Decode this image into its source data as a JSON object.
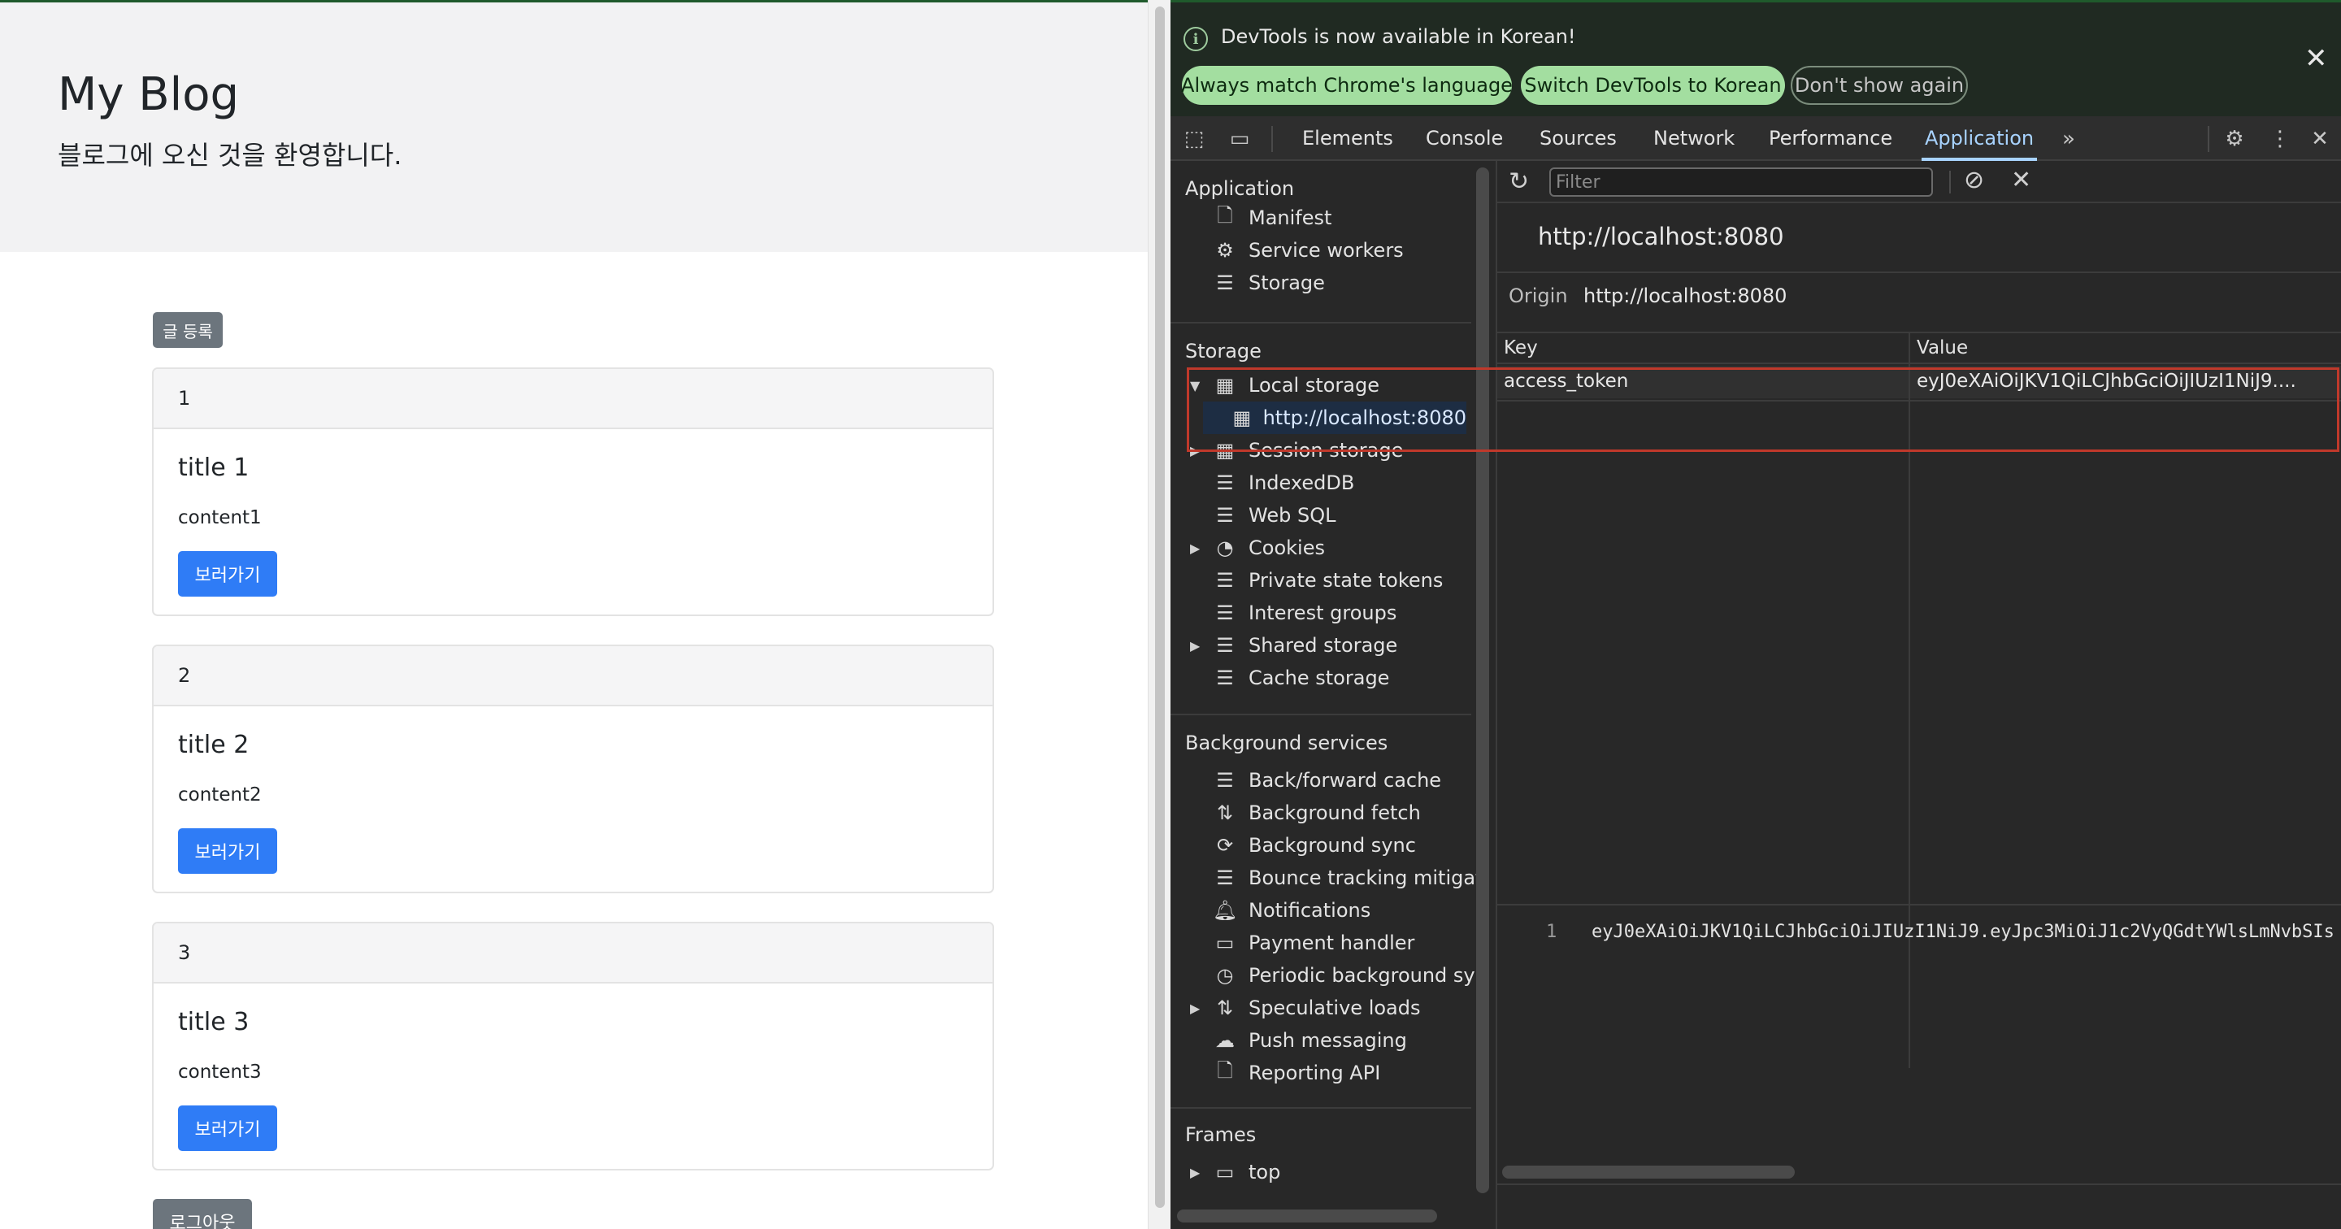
{
  "page": {
    "title": "My Blog",
    "subtitle": "블로그에 오신 것을 환영합니다.",
    "write_button": "글 등록",
    "logout_button": "로그아웃",
    "articles": [
      {
        "id": "1",
        "title": "title 1",
        "content": "content1",
        "button": "보러가기"
      },
      {
        "id": "2",
        "title": "title 2",
        "content": "content2",
        "button": "보러가기"
      },
      {
        "id": "3",
        "title": "title 3",
        "content": "content3",
        "button": "보러가기"
      }
    ]
  },
  "devtools": {
    "infobar": {
      "message": "DevTools is now available in Korean!",
      "buttons": [
        "Always match Chrome's language",
        "Switch DevTools to Korean",
        "Don't show again"
      ]
    },
    "tabs": [
      "Elements",
      "Console",
      "Sources",
      "Network",
      "Performance",
      "Application"
    ],
    "active_tab": "Application",
    "sidebar": {
      "sections": {
        "application": "Application",
        "storage": "Storage",
        "background_services": "Background services",
        "frames": "Frames"
      },
      "application_items": [
        "Manifest",
        "Service workers",
        "Storage"
      ],
      "storage_items": [
        "Local storage",
        "http://localhost:8080",
        "Session storage",
        "IndexedDB",
        "Web SQL",
        "Cookies",
        "Private state tokens",
        "Interest groups",
        "Shared storage",
        "Cache storage"
      ],
      "background_items": [
        "Back/forward cache",
        "Background fetch",
        "Background sync",
        "Bounce tracking mitigati",
        "Notifications",
        "Payment handler",
        "Periodic background syr",
        "Speculative loads",
        "Push messaging",
        "Reporting API"
      ],
      "frames_items": [
        "top"
      ]
    },
    "main": {
      "filter_placeholder": "Filter",
      "origin_title": "http://localhost:8080",
      "origin_label": "Origin",
      "origin_value": "http://localhost:8080",
      "columns": [
        "Key",
        "Value"
      ],
      "rows": [
        {
          "key": "access_token",
          "value": "eyJ0eXAiOiJKV1QiLCJhbGciOiJIUzI1NiJ9...."
        }
      ],
      "preview_line": "1",
      "preview_value": "eyJ0eXAiOiJKV1QiLCJhbGciOiJIUzI1NiJ9.eyJpc3MiOiJ1c2VyQGdtYWlsLmNvbSIs"
    }
  }
}
